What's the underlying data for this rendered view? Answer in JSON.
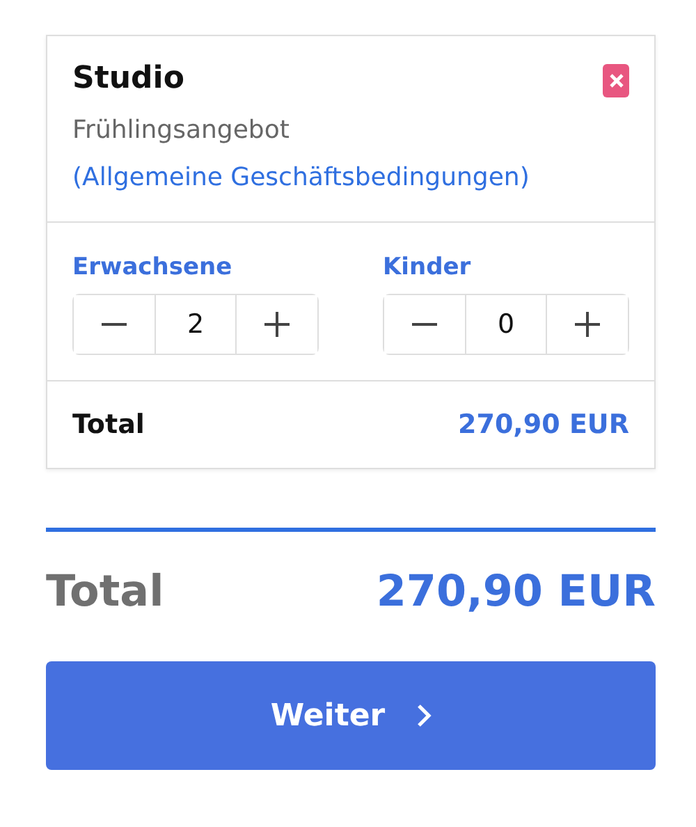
{
  "offer": {
    "title": "Studio",
    "description": "Frühlingsangebot",
    "terms_link": "(Allgemeine Geschäftsbedingungen)"
  },
  "counters": [
    {
      "label": "Erwachsene",
      "value": "2"
    },
    {
      "label": "Kinder",
      "value": "0"
    }
  ],
  "card_total": {
    "label": "Total",
    "amount": "270,90 EUR"
  },
  "summary": {
    "label": "Total",
    "amount": "270,90 EUR"
  },
  "button": {
    "label": "Weiter"
  }
}
